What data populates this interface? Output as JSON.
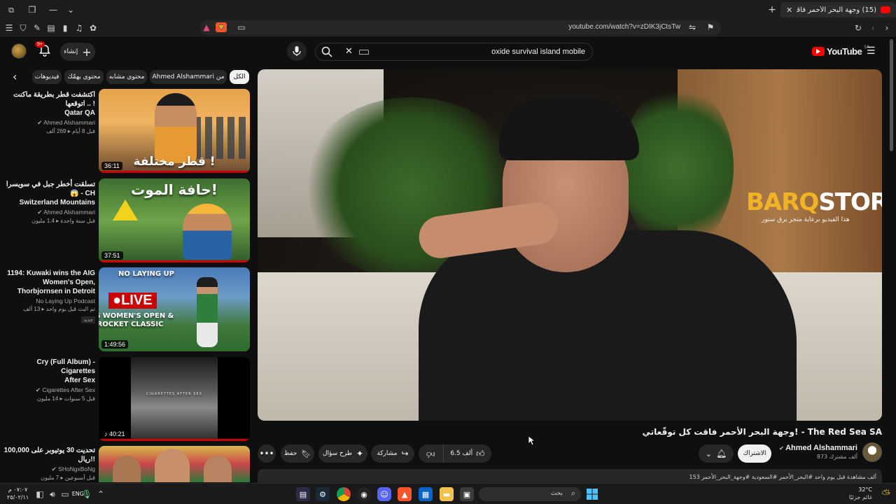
{
  "browser": {
    "tab_title": "(15) وجهة البحر الأحمر فاقت كل",
    "url": "youtube.com/watch?v=zDIK3jCtsTw",
    "tab_badge": "15"
  },
  "header": {
    "logo": "YouTube",
    "region": "SA",
    "search_query": "oxide survival island mobile",
    "create_label": "إنشاء",
    "notif_count": "9+"
  },
  "chips": [
    "الكل",
    "Ahmed Alshammari من",
    "محتوى مشابه",
    "محتوى يهمّك",
    "فيديوهات"
  ],
  "sidebar": [
    {
      "title": "اكتشفت قطر بطريقة ماكنت اتوقعها .. !",
      "title2": "Qatar QA",
      "channel": "Ahmed Alshammari",
      "views": "269 ألف",
      "age": "قبل 8 أيام",
      "duration": "36:11",
      "thumb_text": "قطر مختلفة !"
    },
    {
      "title": "تسلقت أخطر جبل في سويسرا 😱 - CH",
      "title2": "Switzerland Mountains",
      "channel": "Ahmed Alshammari",
      "views": "1.4 مليون",
      "age": "قبل سنة واحدة",
      "duration": "37:51",
      "thumb_text": "حافة الموت!"
    },
    {
      "title": "1194: Kuwaki wins the AIG",
      "title2": "Women's Open, Thorbjornsen in Detroit",
      "channel": "No Laying Up Podcast",
      "views": "13 ألف",
      "age": "تم البث قبل يوم واحد",
      "duration": "1:49:56",
      "badge": "جديد",
      "thumb_text": "LIVE",
      "thumb_sub": "AIG WOMEN'S OPEN & ROCKET CLASSIC",
      "thumb_top": "NO LAYING UP"
    },
    {
      "title": "Cry (Full Album) - Cigarettes",
      "title2": "After Sex",
      "channel": "Cigarettes After Sex",
      "views": "14 مليون",
      "age": "قبل 5 سنوات",
      "duration": "40:21",
      "thumb_text": "CIGARETTES AFTER SEX"
    },
    {
      "title": "تحديت 30 يوتيوبر على 100,000 ريال!!",
      "title2": "",
      "channel": "SHoNgxBoNg",
      "views": "7 مليون",
      "age": "قبل أسبوعين",
      "duration": ""
    }
  ],
  "player": {
    "brand_a": "BARQ",
    "brand_b": "STORE",
    "brand_sub": "هذا الفيديو برعاية متجر برق ستور"
  },
  "video": {
    "title": "وجهة البحر الأحمر فاقت كل توقّعاتي! - The Red Sea SA",
    "channel": "Ahmed Alshammari",
    "subs": "873 ألف مشترك",
    "subscribe": "الاشتراك",
    "likes": "6.5 ألف",
    "share": "مشاركة",
    "ask": "طرح سؤال",
    "save": "حفظ",
    "description": "153 ألف مشاهدة قبل يوم واحد  #البحر_الأحمر  #السعودية  #وجهة_البحر_الأحمر"
  },
  "taskbar": {
    "search": "بحث",
    "lang": "ENG",
    "time": "٠٧:٠٧ م",
    "date": "٢٥/٠٢/١١",
    "weather_temp": "32°C",
    "weather_desc": "غائم جزئيًا"
  }
}
